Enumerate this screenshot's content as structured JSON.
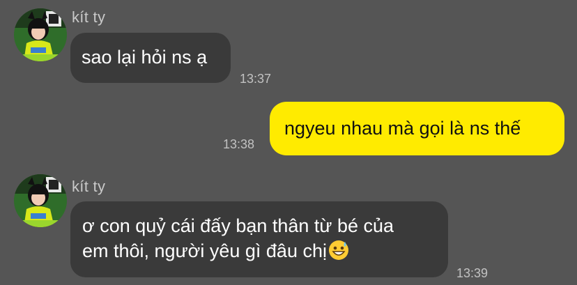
{
  "conversation": {
    "messages": [
      {
        "direction": "incoming",
        "sender": "kít ty",
        "text": "sao lại hỏi ns ạ",
        "time": "13:37"
      },
      {
        "direction": "outgoing",
        "text": "ngyeu nhau mà gọi là ns thế",
        "time": "13:38"
      },
      {
        "direction": "incoming",
        "sender": "kít ty",
        "text_line1": "ơ con quỷ cái đấy bạn thân từ bé của",
        "text_line2": "em thôi, người yêu gì đâu chị",
        "emoji": "grinning-face-with-sweat",
        "time": "13:39"
      }
    ]
  },
  "colors": {
    "background": "#555555",
    "incoming_bubble": "#3a3a3a",
    "outgoing_bubble": "#ffeb00",
    "timestamp": "#c2c2c2"
  }
}
